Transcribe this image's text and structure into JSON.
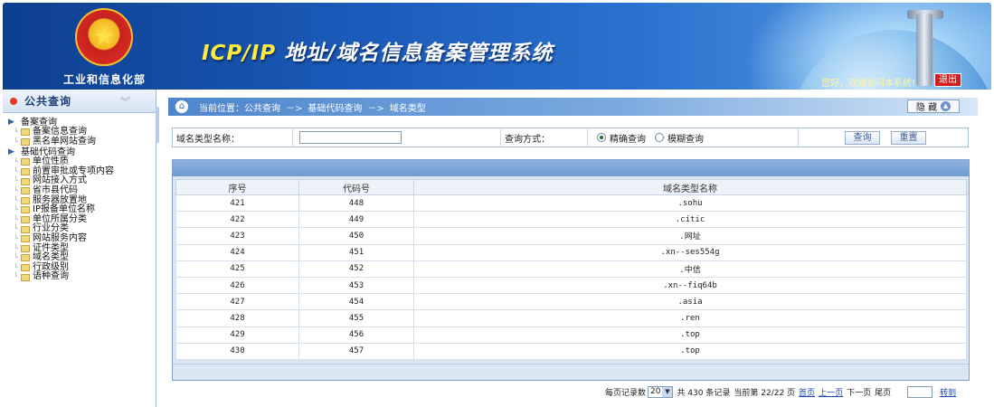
{
  "header": {
    "ministry": "工业和信息化部",
    "title_prefix": "ICP/IP",
    "title_rest": " 地址/域名信息备案管理系统",
    "welcome": "您好，欢迎访问本系统!",
    "logout": "退出"
  },
  "sidebar": {
    "title": "公共查询",
    "groups": [
      {
        "label": "备案查询",
        "items": [
          "备案信息查询",
          "黑名单网站查询"
        ]
      },
      {
        "label": "基础代码查询",
        "items": [
          "单位性质",
          "前置审批或专项内容",
          "网站接入方式",
          "省市县代码",
          "服务器放置地",
          "IP报备单位名称",
          "单位所属分类",
          "行业分类",
          "网站服务内容",
          "证件类型",
          "域名类型",
          "行政级别",
          "语种查询"
        ]
      }
    ]
  },
  "breadcrumb": {
    "prefix": "当前位置：公共查询",
    "arrow": "－>",
    "level2": "基础代码查询",
    "level3": "域名类型",
    "hide_button": "隐 藏"
  },
  "search": {
    "name_label": "域名类型名称：",
    "name_value": "",
    "mode_label": "查询方式：",
    "mode_exact": "精确查询",
    "mode_fuzzy": "模糊查询",
    "query_button": "查询",
    "reset_button": "重置"
  },
  "table": {
    "columns": [
      "序号",
      "代码号",
      "域名类型名称"
    ],
    "rows": [
      [
        "421",
        "448",
        ".sohu"
      ],
      [
        "422",
        "449",
        ".citic"
      ],
      [
        "423",
        "450",
        ".网址"
      ],
      [
        "424",
        "451",
        ".xn--ses554g"
      ],
      [
        "425",
        "452",
        ".中信"
      ],
      [
        "426",
        "453",
        ".xn--fiq64b"
      ],
      [
        "427",
        "454",
        ".asia"
      ],
      [
        "428",
        "455",
        ".ren"
      ],
      [
        "429",
        "456",
        ".top"
      ],
      [
        "430",
        "457",
        ".top"
      ]
    ]
  },
  "pager": {
    "per_page_label": "每页记录数",
    "per_page": "20",
    "total": "共 430 条记录",
    "current": "当前第 22/22 页",
    "first": "首页",
    "prev": "上一页",
    "next": "下一页",
    "last": "尾页",
    "goto": "转到"
  }
}
